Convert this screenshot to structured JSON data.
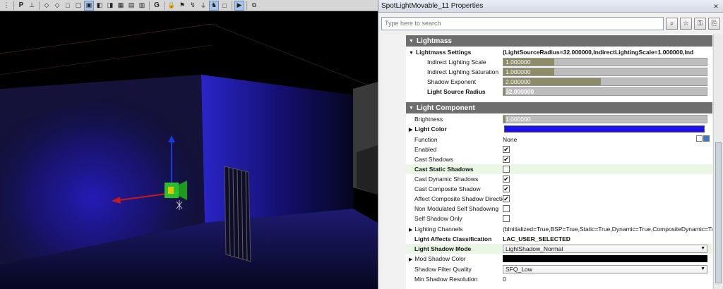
{
  "toolbar": {
    "items": [
      "P",
      "G"
    ]
  },
  "panel": {
    "title": "SpotLightMovable_11 Properties",
    "search_placeholder": "Type here to search",
    "categories": {
      "lightmass": "Lightmass",
      "light_component": "Light Component"
    },
    "rows": {
      "lightmass_settings": {
        "name": "Lightmass Settings",
        "value": "(LightSourceRadius=32.000000,IndirectLightingScale=1.000000,Ind"
      },
      "indirect_lighting_scale": {
        "name": "Indirect Lighting Scale",
        "value": "1.000000",
        "fraction": 0.25
      },
      "indirect_lighting_saturation": {
        "name": "Indirect Lighting Saturation",
        "value": "1.000000",
        "fraction": 0.25
      },
      "shadow_exponent": {
        "name": "Shadow Exponent",
        "value": "2.000000",
        "fraction": 0.48
      },
      "light_source_radius": {
        "name": "Light Source Radius",
        "value": "32.000000",
        "fraction": 0.01
      },
      "brightness": {
        "name": "Brightness",
        "value": "1.000000",
        "fraction": 0.01
      },
      "light_color": {
        "name": "Light Color",
        "color": "#1c0ff0"
      },
      "function": {
        "name": "Function",
        "value": "None"
      },
      "enabled": {
        "name": "Enabled",
        "checked": true
      },
      "cast_shadows": {
        "name": "Cast Shadows",
        "checked": true
      },
      "cast_static_shadows": {
        "name": "Cast Static Shadows",
        "checked": false
      },
      "cast_dynamic_shadows": {
        "name": "Cast Dynamic Shadows",
        "checked": true
      },
      "cast_composite_shadow": {
        "name": "Cast Composite Shadow",
        "checked": true
      },
      "affect_composite_shadow_direction": {
        "name": "Affect Composite Shadow Direction",
        "checked": true
      },
      "non_modulated_self_shadowing": {
        "name": "Non Modulated Self Shadowing",
        "checked": false
      },
      "self_shadow_only": {
        "name": "Self Shadow Only",
        "checked": false
      },
      "lighting_channels": {
        "name": "Lighting Channels",
        "value": "(bInitialized=True,BSP=True,Static=True,Dynamic=True,CompositeDynamic=Tr"
      },
      "light_affects_classification": {
        "name": "Light Affects Classification",
        "value": "LAC_USER_SELECTED"
      },
      "light_shadow_mode": {
        "name": "Light Shadow Mode",
        "value": "LightShadow_Normal"
      },
      "mod_shadow_color": {
        "name": "Mod Shadow Color",
        "color": "#000000"
      },
      "shadow_filter_quality": {
        "name": "Shadow Filter Quality",
        "value": "SFQ_Low"
      },
      "min_shadow_resolution": {
        "name": "Min Shadow Resolution",
        "value": "0"
      }
    }
  },
  "colors": {
    "category_bg": "#6e6e6e",
    "slider_fill": "#8c8c68",
    "highlight_row": "#eaf7e4"
  }
}
